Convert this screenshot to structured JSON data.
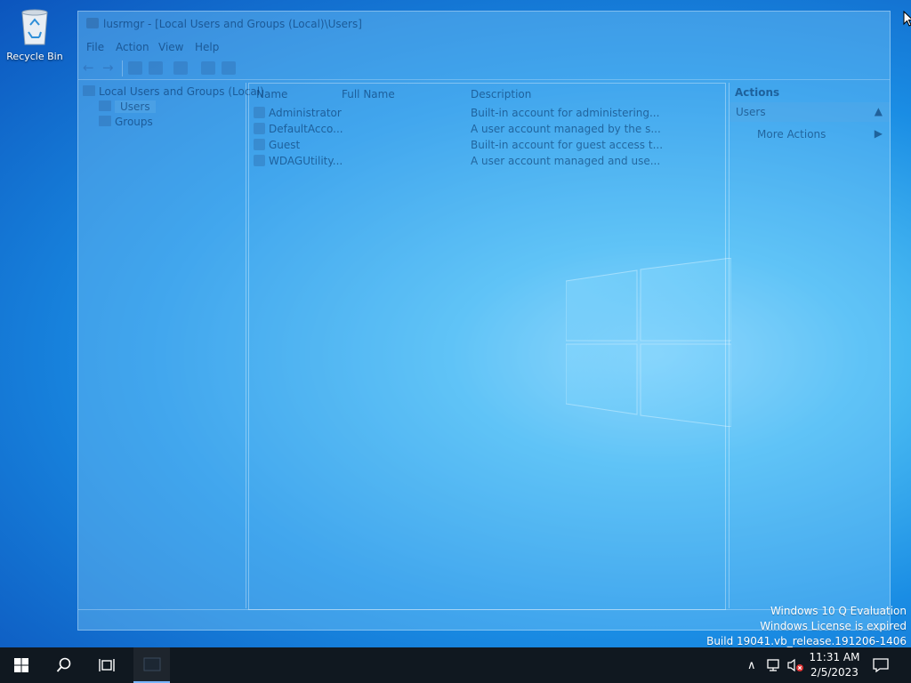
{
  "desktop": {
    "icons": [
      {
        "label": "Recycle Bin",
        "icon": "recycle-bin-icon"
      }
    ],
    "watermark": {
      "line1": "Windows 10 Q Evaluation",
      "line2": "Windows License is expired",
      "line3": "Build 19041.vb_release.191206-1406"
    }
  },
  "window": {
    "title": "lusrmgr - [Local Users and Groups (Local)\\Users]",
    "menu": [
      "File",
      "Action",
      "View",
      "Help"
    ],
    "tree": {
      "root": "Local Users and Groups (Local)",
      "children": [
        "Users",
        "Groups"
      ],
      "selected": "Users"
    },
    "list": {
      "columns": [
        "Name",
        "Full Name",
        "Description"
      ],
      "rows": [
        {
          "name": "Administrator",
          "full_name": "",
          "description": "Built-in account for administering..."
        },
        {
          "name": "DefaultAcco...",
          "full_name": "",
          "description": "A user account managed by the s..."
        },
        {
          "name": "Guest",
          "full_name": "",
          "description": "Built-in account for guest access t..."
        },
        {
          "name": "WDAGUtility...",
          "full_name": "",
          "description": "A user account managed and use..."
        }
      ]
    },
    "actions": {
      "header": "Actions",
      "section": "Users",
      "items": [
        "More Actions"
      ]
    }
  },
  "taskbar": {
    "clock_time": "11:31 AM",
    "clock_date": "2/5/2023"
  }
}
